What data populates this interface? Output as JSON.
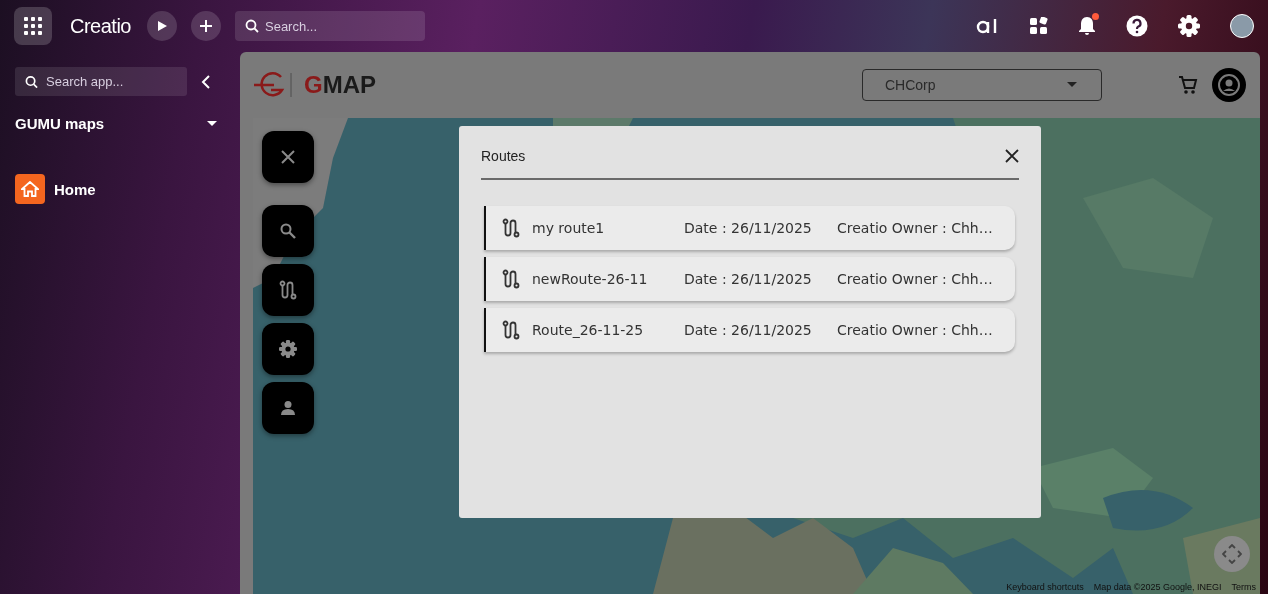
{
  "topbar": {
    "brand": "Creatio",
    "search": {
      "placeholder": "Search..."
    }
  },
  "sidebar": {
    "search": {
      "placeholder": "Search app..."
    },
    "workplace": "GUMU maps",
    "items": [
      {
        "label": "Home",
        "selected": false
      }
    ]
  },
  "app": {
    "logo_letter": "G",
    "logo_rest": "MAP",
    "company": "CHCorp"
  },
  "map": {
    "kind": "picture",
    "footer": [
      "Keyboard shortcuts",
      "Map data ©2025 Google, INEGI",
      "Terms"
    ]
  },
  "dialog": {
    "title": "Routes",
    "routes": [
      {
        "name": "my route1",
        "date": "Date : 26/11/2025",
        "owner": "Creatio Owner : Chh…"
      },
      {
        "name": "newRoute-26-11",
        "date": "Date : 26/11/2025",
        "owner": "Creatio Owner : Chh…"
      },
      {
        "name": "Route_26-11-25",
        "date": "Date : 26/11/2025",
        "owner": "Creatio Owner : Chh…"
      }
    ]
  }
}
